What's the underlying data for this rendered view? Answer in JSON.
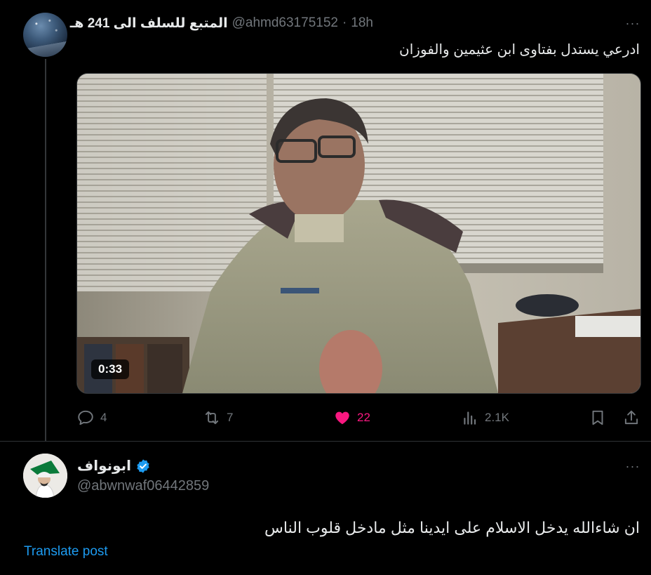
{
  "tweet1": {
    "display_name": "المتبع للسلف الى 241 هـ",
    "handle": "@ahmd63175152",
    "separator": "·",
    "time": "18h",
    "text": "ادرعي يستدل بفتاوى ابن عثيمين والفوزان",
    "video": {
      "duration": "0:33"
    },
    "actions": {
      "replies": "4",
      "reposts": "7",
      "likes": "22",
      "views": "2.1K"
    },
    "more_label": "···"
  },
  "tweet2": {
    "display_name": "ابونواف",
    "handle": "@abwnwaf06442859",
    "text": "ان شاءالله يدخل الاسلام على ايدينا مثل مادخل قلوب الناس",
    "translate_label": "Translate post",
    "more_label": "···"
  },
  "colors": {
    "background": "#000000",
    "text_primary": "#e7e9ea",
    "text_secondary": "#71767b",
    "like_pink": "#f91880",
    "link_blue": "#1d9bf0",
    "verified_blue": "#1d9bf0"
  }
}
